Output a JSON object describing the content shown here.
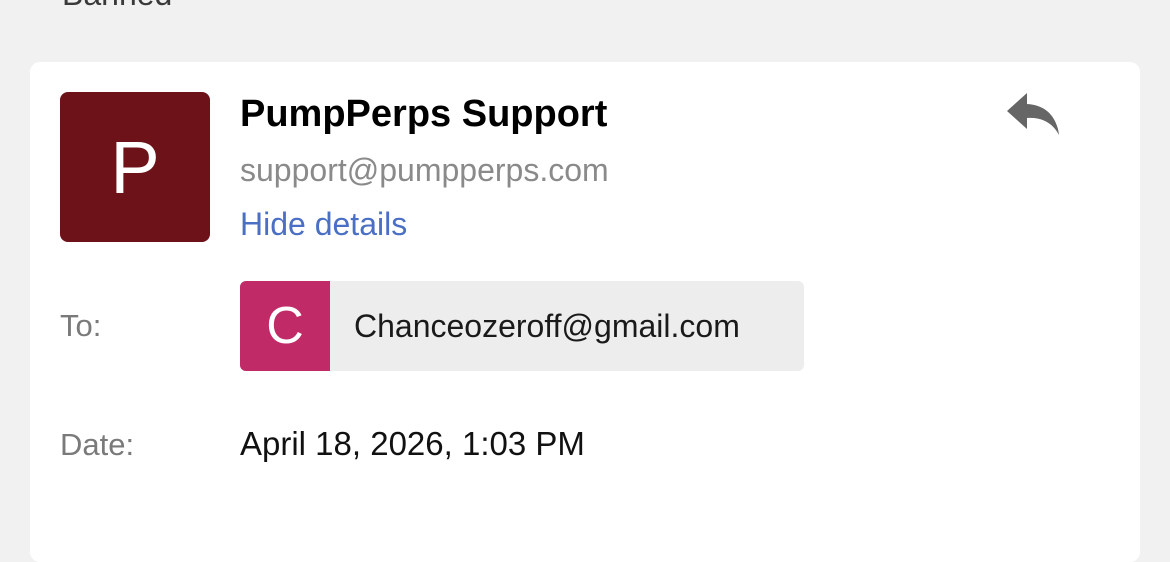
{
  "previous_subject": "Banned",
  "sender": {
    "initial": "P",
    "name": "PumpPerps Support",
    "email": "support@pumpperps.com",
    "hide_details_label": "Hide details"
  },
  "recipient": {
    "label": "To:",
    "initial": "C",
    "email": "Chanceozeroff@gmail.com"
  },
  "date": {
    "label": "Date:",
    "value": "April 18, 2026, 1:03 PM"
  },
  "icons": {
    "reply": "reply-arrow-icon"
  },
  "colors": {
    "sender_avatar": "#6e1219",
    "recipient_avatar": "#c02a66",
    "link": "#4a6fc4",
    "icon": "#666666"
  }
}
